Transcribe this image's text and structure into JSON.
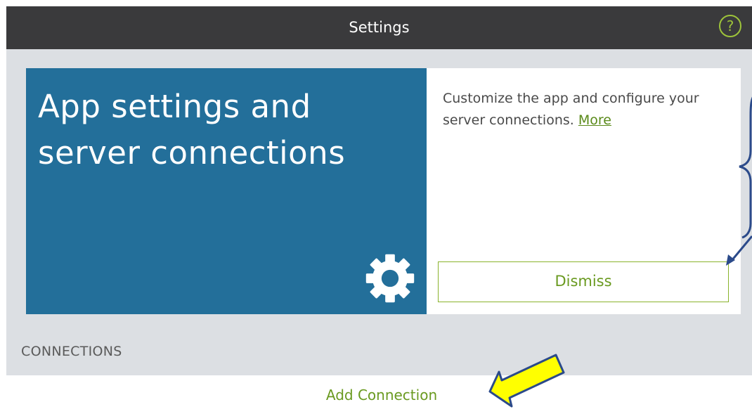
{
  "navbar": {
    "title": "Settings",
    "help_icon": "question-circle-icon",
    "help_glyph": "?"
  },
  "card": {
    "hero_title": "App settings and server connections",
    "hero_icon": "gear-icon",
    "description": "Customize the app and configure your server connections.",
    "more_link": "More",
    "dismiss_label": "Dismiss"
  },
  "connections": {
    "header": "CONNECTIONS",
    "add_label": "Add Connection"
  },
  "colors": {
    "navbar": "#3a3a3c",
    "hero": "#236f9a",
    "accent_green": "#8ab32c",
    "background": "#dcdfe3",
    "annotation_arrow_yellow": "#ffff00"
  }
}
